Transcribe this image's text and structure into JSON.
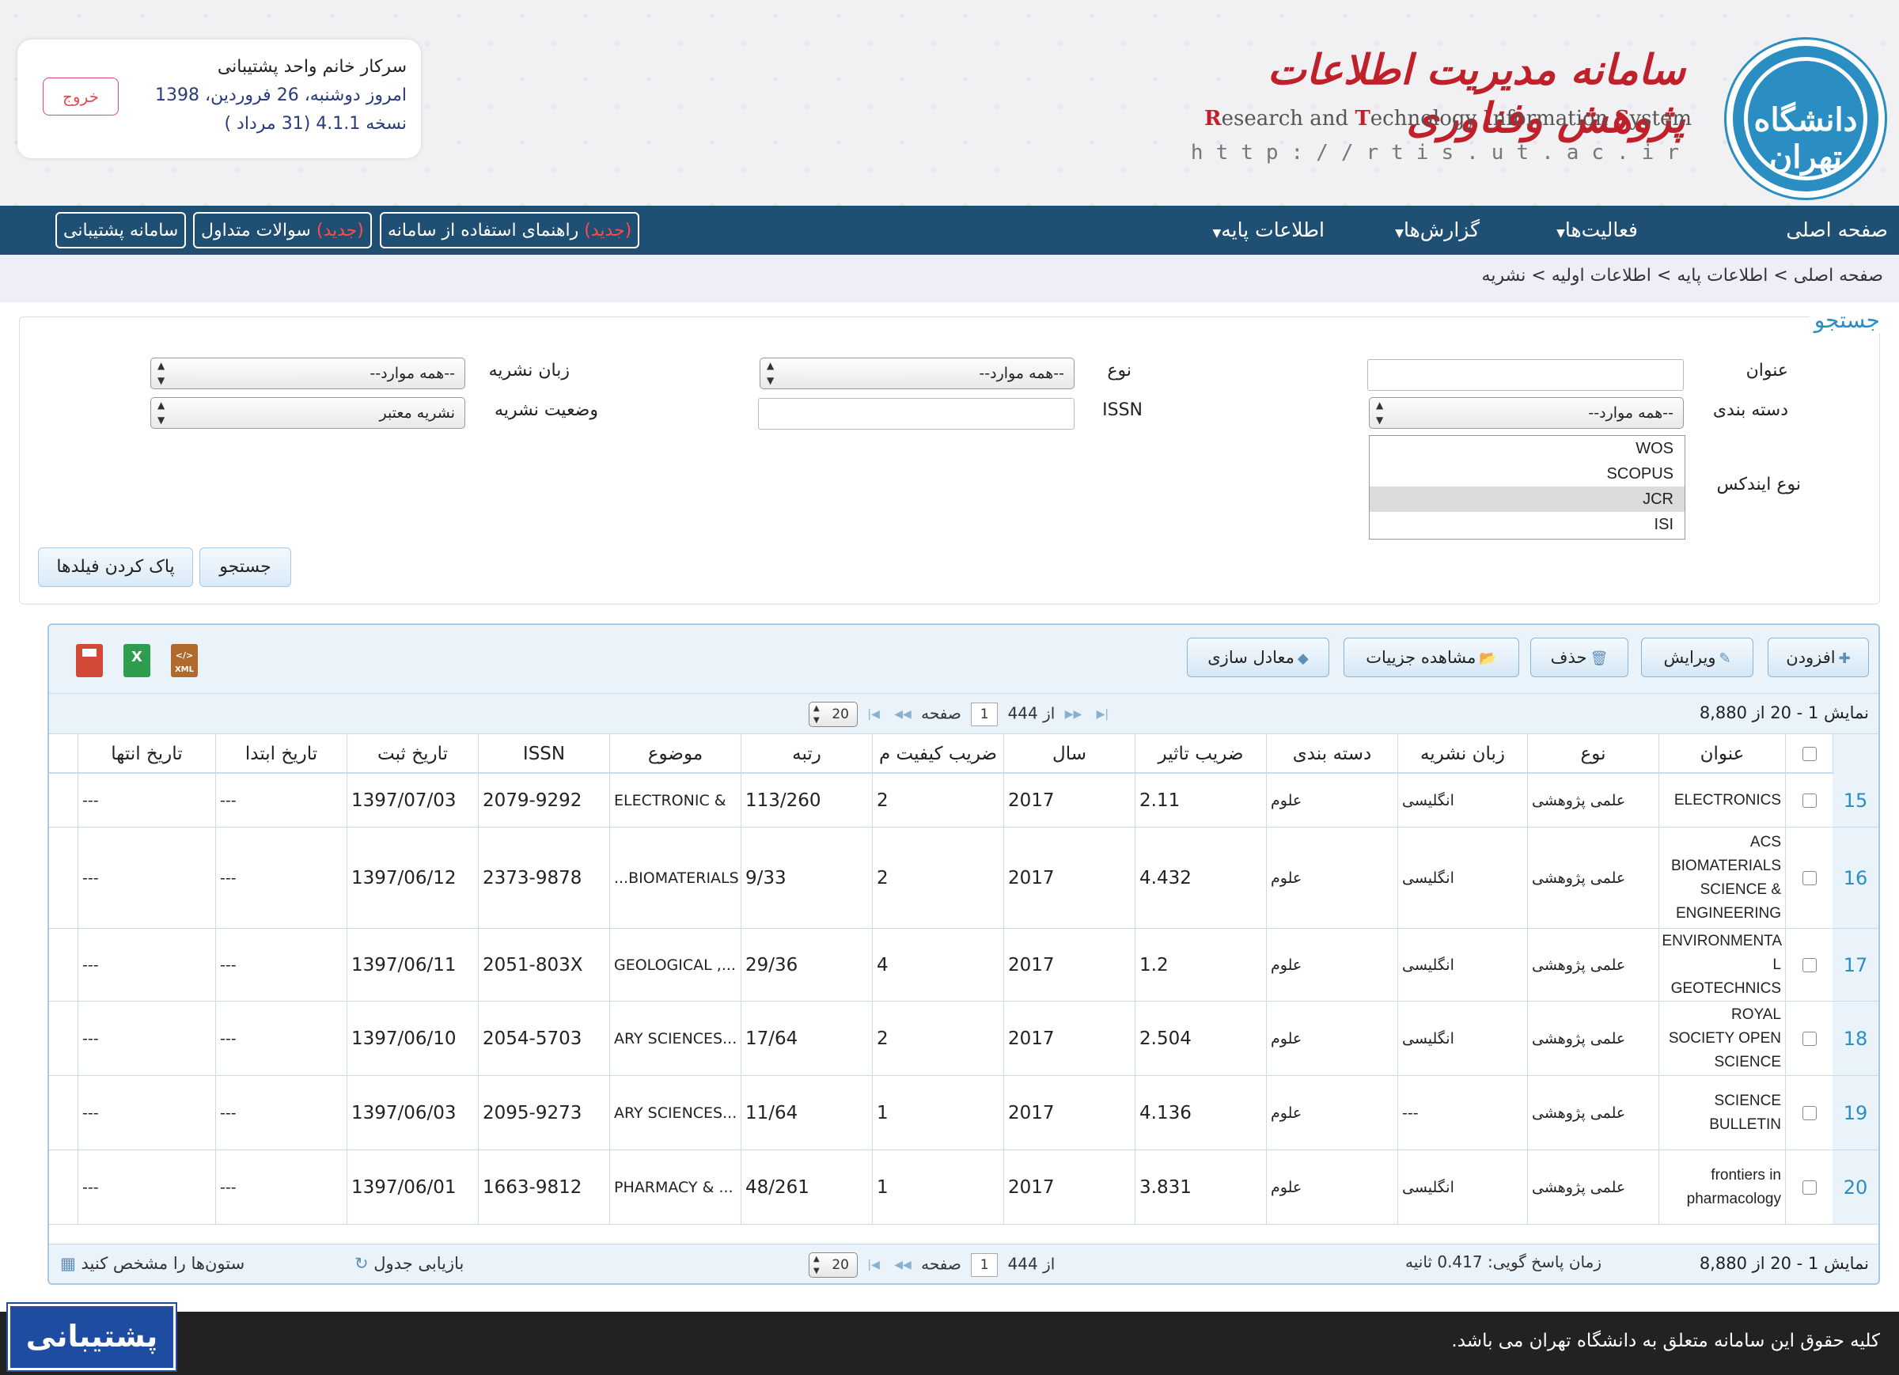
{
  "header": {
    "title_fa": "سامانه مدیریت اطلاعات پژوهش وفناوری",
    "title_en_parts": [
      {
        "cap": "R",
        "rest": "esearch and "
      },
      {
        "cap": "T",
        "rest": "echnology "
      },
      {
        "cap": "I",
        "rest": "nformation "
      },
      {
        "cap": "S",
        "rest": "ystem"
      }
    ],
    "url": "http://rtis.ut.ac.ir",
    "logo_text": "دانشگاه تهران"
  },
  "user": {
    "greeting_prefix": "سرکار خانم",
    "name": "واحد پشتیبانی",
    "date_line": "امروز دوشنبه، 26 فروردین، 1398",
    "version_line": "نسخه 4.1.1 (31 مرداد )",
    "logout_label": "خروج"
  },
  "nav": {
    "items": [
      "صفحه اصلی",
      "فعالیت‌ها",
      "گزارش‌ها",
      "اطلاعات پایه"
    ],
    "links": [
      {
        "new": "(جدید)",
        "label": "راهنمای استفاده از سامانه"
      },
      {
        "new": "(جدید)",
        "label": "سوالات متداول"
      },
      {
        "new": "",
        "label": "سامانه پشتیبانی"
      }
    ]
  },
  "breadcrumb": "صفحه اصلی > اطلاعات پایه > اطلاعات اولیه > نشریه",
  "search": {
    "title": "جستجو",
    "labels": {
      "title": "عنوان",
      "type": "نوع",
      "language": "زبان نشریه",
      "category": "دسته بندی",
      "issn": "ISSN",
      "status": "وضعیت نشریه",
      "index_type": "نوع ایندکس"
    },
    "values": {
      "type": "--همه موارد--",
      "language": "--همه موارد--",
      "category": "--همه موارد--",
      "status": "نشریه معتبر"
    },
    "index_options": [
      "WOS",
      "SCOPUS",
      "JCR",
      "ISI"
    ],
    "index_selected": "JCR",
    "search_button": "جستجو",
    "clear_button": "پاک کردن فیلدها"
  },
  "toolbar": {
    "add": "افزودن",
    "edit": "ویرایش",
    "delete": "حذف",
    "details": "مشاهده جزییات",
    "equalize": "معادل سازی"
  },
  "pager": {
    "info": "نمایش 1 - 20 از 8,880",
    "page_label": "صفحه",
    "page": "1",
    "of_label": "از 444",
    "page_size": "20",
    "response_time": "زمان پاسخ گویی: 0.417 ثانیه",
    "reload": "بازیابی جدول",
    "columns": "ستون‌ها را مشخص کنید"
  },
  "table": {
    "columns": [
      "عنوان",
      "نوع",
      "زبان نشریه",
      "دسته بندی",
      "ضریب تاثیر",
      "سال",
      "ضریب کیفیت م",
      "رتبه",
      "موضوع",
      "ISSN",
      "تاریخ ثبت",
      "تاریخ ابتدا",
      "تاریخ انتها"
    ],
    "rows": [
      {
        "num": "15",
        "title": "ELECTRONICS",
        "type": "علمی پژوهشی",
        "lang": "انگلیسی",
        "cat": "علوم",
        "if": "2.11",
        "year": "2017",
        "q": "2",
        "rank": "113/260",
        "subject": "& ELECTRONIC",
        "issn": "2079-9292",
        "reg": "1397/07/03",
        "start": "---",
        "end": "---"
      },
      {
        "num": "16",
        "title": "ACS BIOMATERIALS SCIENCE & ENGINEERING",
        "type": "علمی پژوهشی",
        "lang": "انگلیسی",
        "cat": "علوم",
        "if": "4.432",
        "year": "2017",
        "q": "2",
        "rank": "9/33",
        "subject": "BIOMATERIALS...",
        "issn": "2373-9878",
        "reg": "1397/06/12",
        "start": "---",
        "end": "---"
      },
      {
        "num": "17",
        "title": "ENVIRONMENTA L GEOTECHNICS",
        "type": "علمی پژوهشی",
        "lang": "انگلیسی",
        "cat": "علوم",
        "if": "1.2",
        "year": "2017",
        "q": "4",
        "rank": "29/36",
        "subject": "..., GEOLOGICAL",
        "issn": "2051-803X",
        "reg": "1397/06/11",
        "start": "---",
        "end": "---"
      },
      {
        "num": "18",
        "title": "ROYAL SOCIETY OPEN SCIENCE",
        "type": "علمی پژوهشی",
        "lang": "انگلیسی",
        "cat": "علوم",
        "if": "2.504",
        "year": "2017",
        "q": "2",
        "rank": "17/64",
        "subject": "...ARY SCIENCES",
        "issn": "2054-5703",
        "reg": "1397/06/10",
        "start": "---",
        "end": "---"
      },
      {
        "num": "19",
        "title": "SCIENCE BULLETIN",
        "type": "علمی پژوهشی",
        "lang": "---",
        "cat": "علوم",
        "if": "4.136",
        "year": "2017",
        "q": "1",
        "rank": "11/64",
        "subject": "...ARY SCIENCES",
        "issn": "2095-9273",
        "reg": "1397/06/03",
        "start": "---",
        "end": "---"
      },
      {
        "num": "20",
        "title": "frontiers in pharmacology",
        "type": "علمی پژوهشی",
        "lang": "انگلیسی",
        "cat": "علوم",
        "if": "3.831",
        "year": "2017",
        "q": "1",
        "rank": "48/261",
        "subject": "... & PHARMACY",
        "issn": "1663-9812",
        "reg": "1397/06/01",
        "start": "---",
        "end": "---"
      }
    ]
  },
  "footer": {
    "copyright": "کلیه حقوق این سامانه متعلق به دانشگاه تهران می باشد.",
    "support_label": "پشتیبانی"
  },
  "colors": {
    "nav_bg": "#1f4f72",
    "accent": "#2b8ec2",
    "new_badge": "#ff4a4a",
    "footer_bg": "#222222",
    "support_btn": "#1d4ca0"
  }
}
